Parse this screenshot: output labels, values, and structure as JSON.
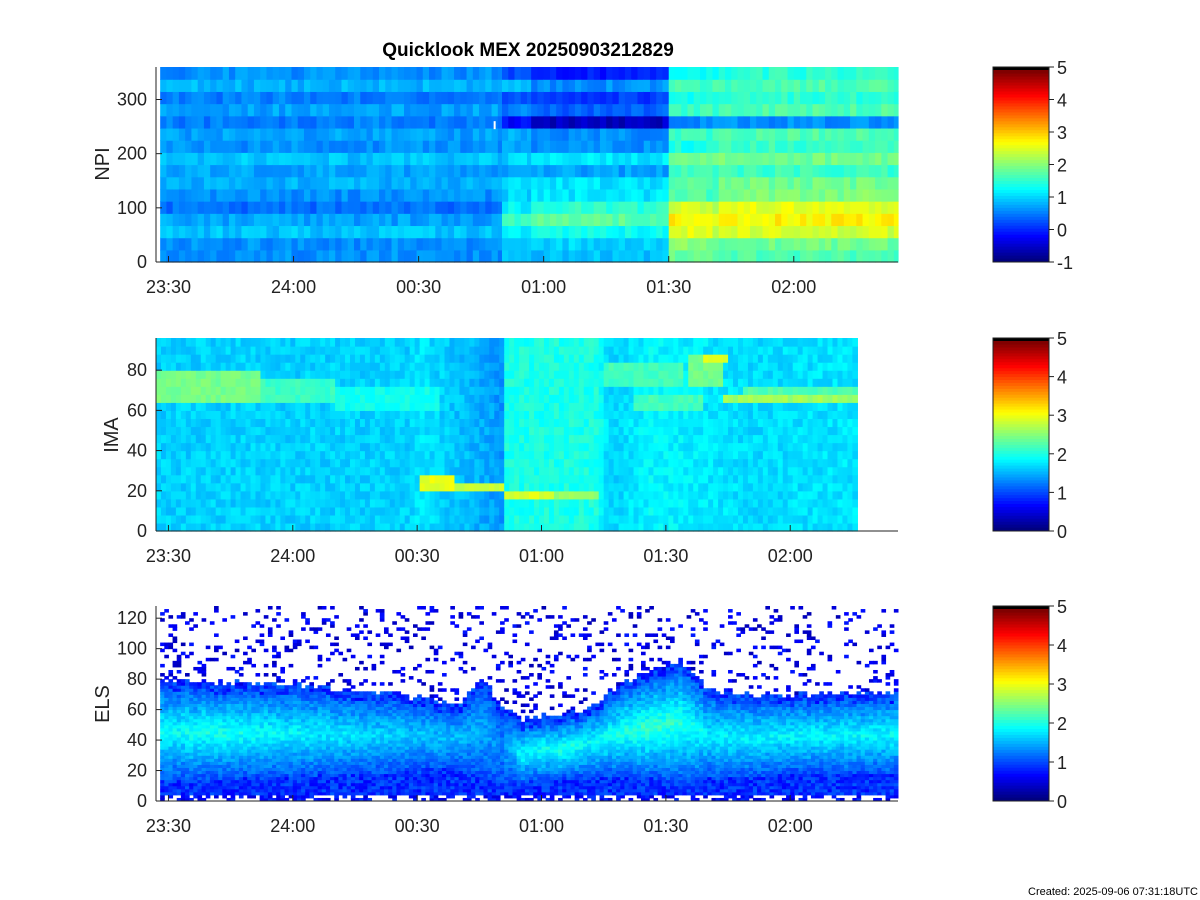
{
  "figure_title": "Quicklook MEX 20250903212829",
  "created_label": "Created: 2025-09-06 07:31:18UTC",
  "colormap": "jet",
  "chart_data": [
    {
      "type": "heatmap",
      "ylabel": "NPI",
      "x_tick_labels": [
        "23:30",
        "24:00",
        "00:30",
        "01:00",
        "01:30",
        "02:00"
      ],
      "x_ticks_min": [
        -30,
        0,
        30,
        60,
        90,
        120
      ],
      "x_range_min": [
        -33,
        145
      ],
      "data_x_range_min": [
        -32,
        145
      ],
      "ylim": [
        0,
        360
      ],
      "y_ticks": [
        0,
        100,
        200,
        300
      ],
      "data_ylim": [
        0,
        360
      ],
      "rows": 16,
      "colorbar": {
        "min": -1,
        "max": 5,
        "ticks": [
          -1,
          0,
          1,
          2,
          3,
          4,
          5
        ]
      },
      "segments_min": [
        -32,
        50,
        57,
        90,
        102,
        145
      ],
      "values": [
        [
          0.6,
          0.6,
          0.9,
          0.7,
          0.4,
          0.6,
          0.8,
          0.7,
          0.9,
          0.6,
          0.7,
          0.5,
          0.7,
          0.5,
          0.8,
          0.6
        ],
        [
          0.9,
          1.0,
          1.1,
          1.6,
          1.2,
          1.0,
          1.1,
          0.6,
          1.0,
          0.7,
          0.8,
          -0.2,
          0.5,
          0.3,
          0.8,
          0.2
        ],
        [
          0.9,
          1.0,
          1.3,
          1.8,
          1.5,
          1.1,
          1.1,
          0.7,
          1.1,
          0.6,
          0.6,
          -0.6,
          0.3,
          0.1,
          0.6,
          -0.1
        ],
        [
          1.7,
          1.9,
          2.4,
          2.6,
          2.3,
          1.6,
          1.6,
          1.6,
          1.9,
          1.4,
          1.6,
          0.6,
          1.6,
          1.4,
          1.6,
          1.3
        ],
        [
          1.7,
          1.9,
          2.5,
          2.8,
          2.6,
          2.0,
          1.9,
          1.6,
          1.9,
          1.6,
          1.7,
          0.6,
          1.7,
          1.5,
          1.7,
          1.5
        ],
        [
          0.7,
          0.6,
          1.2,
          1.4,
          1.2,
          0.9,
          1.0,
          0.6,
          1.0,
          0.6,
          0.7,
          -0.2,
          0.6,
          0.3,
          0.8,
          0.3
        ]
      ]
    },
    {
      "type": "heatmap",
      "ylabel": "IMA",
      "x_tick_labels": [
        "23:30",
        "24:00",
        "00:30",
        "01:00",
        "01:30",
        "02:00"
      ],
      "x_ticks_min": [
        -30,
        0,
        30,
        60,
        90,
        120
      ],
      "x_range_min": [
        -33,
        146
      ],
      "data_x_range_min": [
        -33,
        136
      ],
      "ylim": [
        0,
        96
      ],
      "y_ticks": [
        0,
        20,
        40,
        60,
        80
      ],
      "data_ylim": [
        0,
        96
      ],
      "rows": 24,
      "colorbar": {
        "min": 0,
        "max": 5,
        "ticks": [
          0,
          1,
          2,
          3,
          4,
          5
        ]
      },
      "background": 1.8,
      "gradient": [
        [
          -33,
          1.65
        ],
        [
          27,
          1.65
        ],
        [
          30,
          1.75
        ],
        [
          46,
          1.45
        ],
        [
          50,
          1.35
        ],
        [
          51,
          2.0
        ],
        [
          73,
          2.0
        ],
        [
          76,
          1.65
        ],
        [
          86,
          1.85
        ],
        [
          110,
          1.7
        ],
        [
          136,
          1.75
        ]
      ],
      "features": [
        {
          "x": [
            -33,
            -8
          ],
          "y": [
            64,
            80
          ],
          "value": 2.45
        },
        {
          "x": [
            -8,
            10
          ],
          "y": [
            64,
            76
          ],
          "value": 2.15
        },
        {
          "x": [
            10,
            35
          ],
          "y": [
            60,
            72
          ],
          "value": 1.95
        },
        {
          "x": [
            30,
            38
          ],
          "y": [
            20,
            28
          ],
          "value": 3.0
        },
        {
          "x": [
            38,
            50
          ],
          "y": [
            20,
            24
          ],
          "value": 2.85
        },
        {
          "x": [
            50,
            62
          ],
          "y": [
            18,
            22
          ],
          "value": 2.95
        },
        {
          "x": [
            62,
            73
          ],
          "y": [
            18,
            22
          ],
          "value": 2.6
        },
        {
          "x": [
            74,
            94
          ],
          "y": [
            72,
            84
          ],
          "value": 2.2
        },
        {
          "x": [
            82,
            98
          ],
          "y": [
            60,
            68
          ],
          "value": 2.2
        },
        {
          "x": [
            95,
            103
          ],
          "y": [
            72,
            88
          ],
          "value": 2.45
        },
        {
          "x": [
            98,
            104
          ],
          "y": [
            84,
            88
          ],
          "value": 2.95
        },
        {
          "x": [
            103,
            136
          ],
          "y": [
            66,
            70
          ],
          "value": 2.65
        },
        {
          "x": [
            108,
            136
          ],
          "y": [
            68,
            72
          ],
          "value": 2.25
        }
      ]
    },
    {
      "type": "heatmap",
      "ylabel": "ELS",
      "x_tick_labels": [
        "23:30",
        "24:00",
        "00:30",
        "01:00",
        "01:30",
        "02:00"
      ],
      "x_ticks_min": [
        -30,
        0,
        30,
        60,
        90,
        120
      ],
      "x_range_min": [
        -33,
        146
      ],
      "data_x_range_min": [
        -32,
        146
      ],
      "ylim": [
        0,
        128
      ],
      "y_ticks": [
        0,
        20,
        40,
        60,
        80,
        100,
        120
      ],
      "data_ylim": [
        0,
        128
      ],
      "colorbar": {
        "min": 0,
        "max": 5,
        "ticks": [
          0,
          1,
          2,
          3,
          4,
          5
        ]
      },
      "band_profile": [
        [
          -32,
          78,
          14,
          1.9
        ],
        [
          -20,
          76,
          14,
          2.0
        ],
        [
          0,
          74,
          16,
          1.85
        ],
        [
          20,
          70,
          18,
          1.7
        ],
        [
          30,
          66,
          20,
          1.6
        ],
        [
          40,
          62,
          22,
          1.55
        ],
        [
          45,
          80,
          16,
          1.5
        ],
        [
          50,
          60,
          12,
          1.3
        ],
        [
          55,
          52,
          12,
          1.9
        ],
        [
          65,
          55,
          14,
          2.0
        ],
        [
          72,
          60,
          16,
          1.9
        ],
        [
          78,
          75,
          16,
          2.0
        ],
        [
          85,
          82,
          14,
          2.15
        ],
        [
          93,
          90,
          12,
          2.1
        ],
        [
          100,
          72,
          14,
          1.8
        ],
        [
          110,
          68,
          16,
          1.85
        ],
        [
          125,
          68,
          18,
          1.85
        ],
        [
          146,
          70,
          18,
          1.9
        ]
      ]
    }
  ]
}
